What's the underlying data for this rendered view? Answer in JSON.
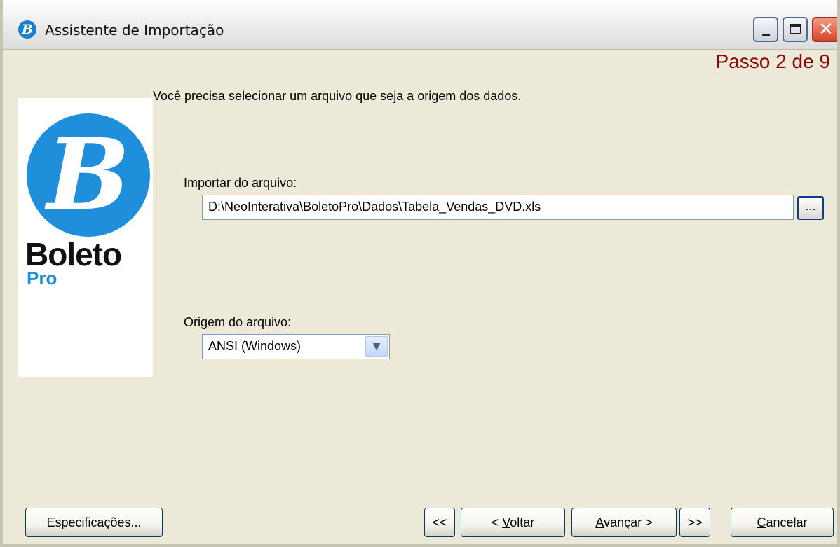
{
  "window": {
    "title": "Assistente de Importação",
    "app_icon": "boletopro-icon",
    "controls": {
      "minimize": "minimize-icon",
      "maximize": "maximize-icon",
      "close": "close-icon"
    }
  },
  "step_indicator": "Passo 2 de 9",
  "instruction": "Você precisa selecionar um arquivo que seja a origem dos dados.",
  "logo": {
    "word": "Boleto",
    "sub": "Pro",
    "brand_color": "#1f8fdc"
  },
  "import_file": {
    "label": "Importar do arquivo:",
    "value": "D:\\NeoInterativa\\BoletoPro\\Dados\\Tabela_Vendas_DVD.xls",
    "browse_label": "..."
  },
  "file_origin": {
    "label": "Origem do arquivo:",
    "selected": "ANSI (Windows)"
  },
  "buttons": {
    "specs": "Especificações...",
    "first": "<<",
    "back_prefix": "< ",
    "back_mnemonic": "V",
    "back_rest": "oltar",
    "next_mnemonic": "A",
    "next_rest": "vançar >",
    "last": ">>",
    "cancel_mnemonic": "C",
    "cancel_rest": "ancelar"
  },
  "colors": {
    "step_text": "#8b0000",
    "window_bg": "#ece9d8"
  }
}
